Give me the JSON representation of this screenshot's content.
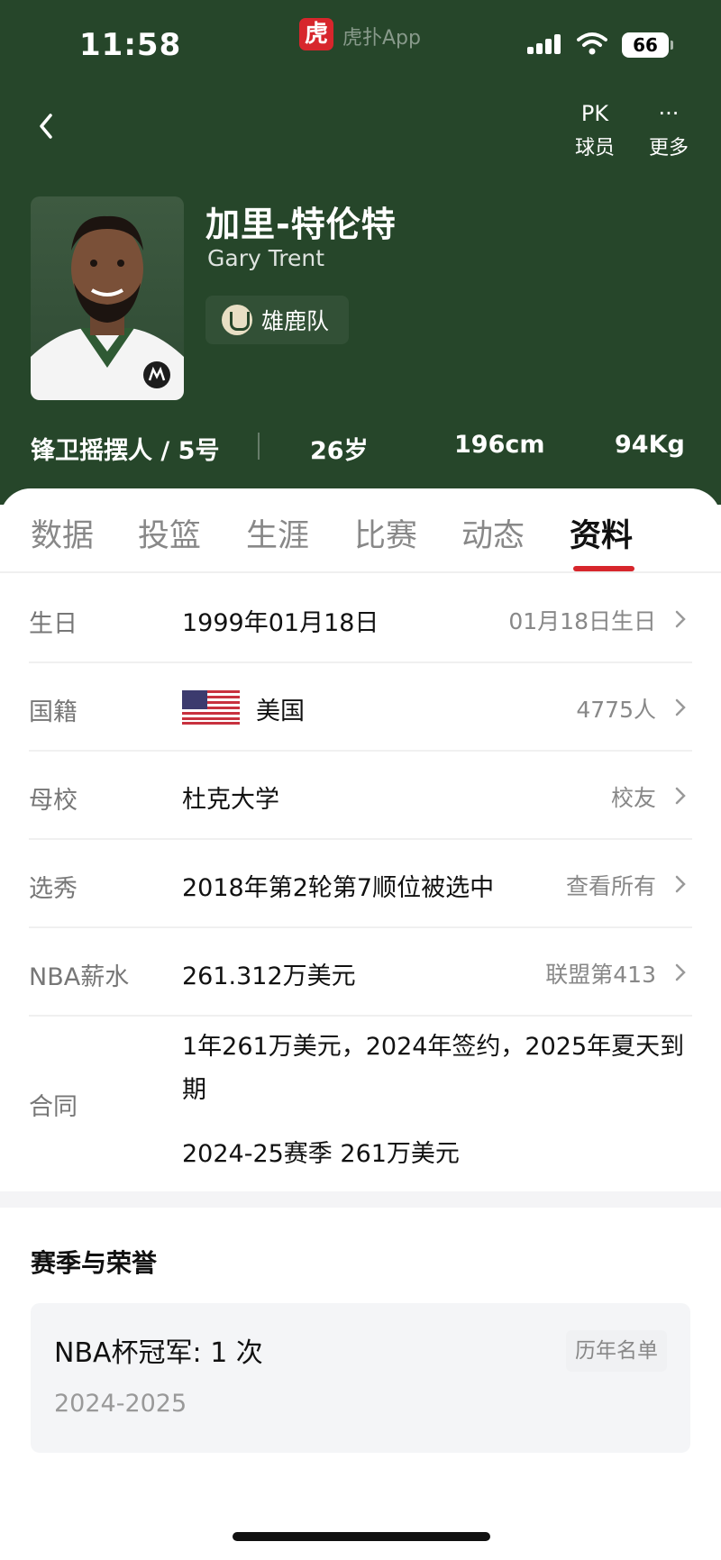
{
  "status_bar": {
    "time": "11:58",
    "app_badge": "虎",
    "app_name": "虎扑App",
    "battery": "66"
  },
  "nav": {
    "pk_icon": "PK",
    "pk_label": "球员",
    "more_icon": "···",
    "more_label": "更多"
  },
  "player": {
    "name_cn": "加里-特伦特",
    "name_en": "Gary Trent",
    "team": "雄鹿队",
    "position_number": "锋卫摇摆人 / 5号",
    "age": "26岁",
    "height": "196cm",
    "weight": "94Kg"
  },
  "tabs": [
    {
      "label": "数据"
    },
    {
      "label": "投篮"
    },
    {
      "label": "生涯"
    },
    {
      "label": "比赛"
    },
    {
      "label": "动态"
    },
    {
      "label": "资料"
    }
  ],
  "active_tab": "资料",
  "info": [
    {
      "label": "生日",
      "value": "1999年01月18日",
      "link": "01月18日生日"
    },
    {
      "label": "国籍",
      "value": "美国",
      "link": "4775人"
    },
    {
      "label": "母校",
      "value": "杜克大学",
      "link": "校友"
    },
    {
      "label": "选秀",
      "value": "2018年第2轮第7顺位被选中",
      "link": "查看所有"
    },
    {
      "label": "NBA薪水",
      "value": "261.312万美元",
      "link": "联盟第413"
    }
  ],
  "contract": {
    "label": "合同",
    "text": "1年261万美元，2024年签约，2025年夏天到期",
    "season": "2024-25赛季 261万美元"
  },
  "honors": {
    "title": "赛季与荣誉",
    "items": [
      {
        "name": "NBA杯冠军: 1 次",
        "years": "2024-2025",
        "button": "历年名单"
      }
    ]
  },
  "colors": {
    "header_green": "#26462a",
    "accent_red": "#d7262c"
  },
  "icons": [
    "back-arrow-icon",
    "pk-icon",
    "more-icon",
    "chevron-right-icon",
    "us-flag-icon",
    "bucks-logo-icon"
  ]
}
